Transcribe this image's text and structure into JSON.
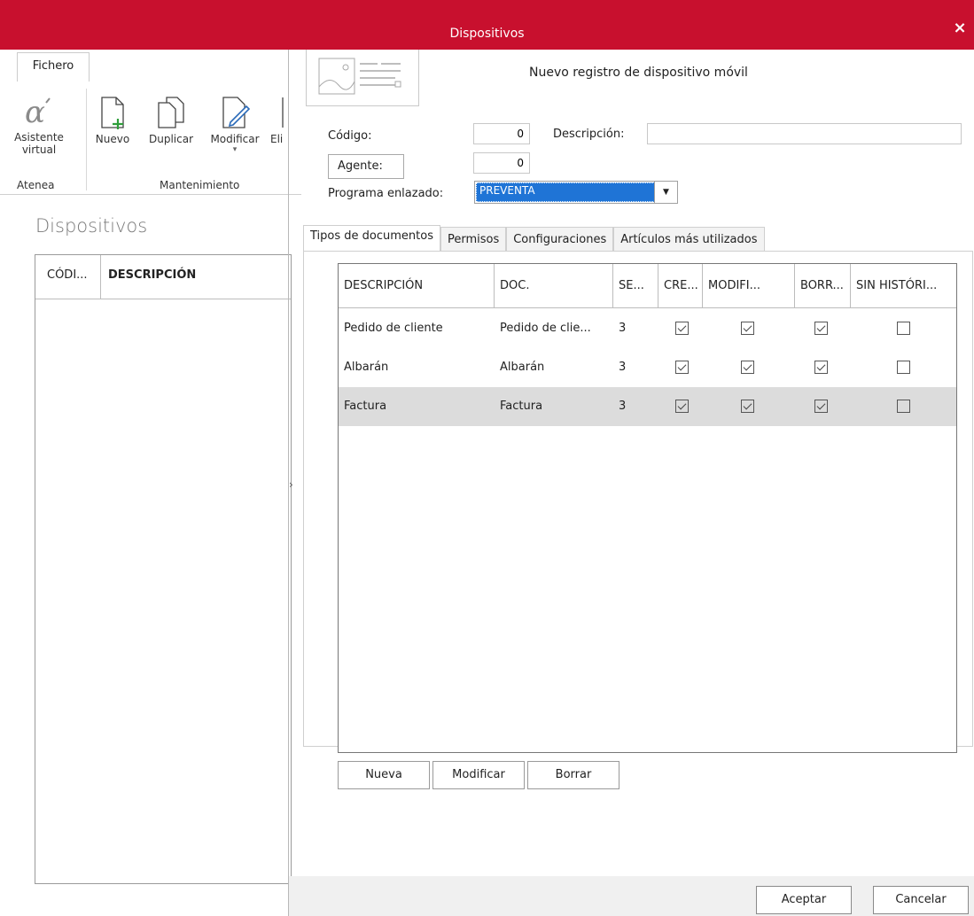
{
  "window": {
    "title": "Dispositivos",
    "close": "×"
  },
  "ribbon": {
    "tab": "Fichero",
    "buttons": {
      "asistente_line1": "Asistente",
      "asistente_line2": "virtual",
      "nuevo": "Nuevo",
      "duplicar": "Duplicar",
      "modificar": "Modificar",
      "eliminar_partial": "Eli"
    },
    "groups": {
      "atenea": "Atenea",
      "mantenimiento": "Mantenimiento"
    }
  },
  "left_panel": {
    "title": "Dispositivos",
    "columns": [
      "CÓDI...",
      "DESCRIPCIÓN"
    ],
    "expander": "›"
  },
  "dialog": {
    "header": "Nuevo registro de dispositivo móvil",
    "codigo_label": "Código:",
    "codigo_value": "0",
    "descripcion_label": "Descripción:",
    "descripcion_value": "",
    "agente_label": "Agente:",
    "agente_value": "0",
    "programa_label": "Programa enlazado:",
    "programa_value": "PREVENTA"
  },
  "tabs": [
    "Tipos de documentos",
    "Permisos",
    "Configuraciones",
    "Artículos más utilizados"
  ],
  "grid": {
    "columns": [
      "DESCRIPCIÓN",
      "DOC.",
      "SE...",
      "CRE...",
      "MODIFI...",
      "BORR...",
      "SIN HISTÓRI..."
    ],
    "rows": [
      {
        "descripcion": "Pedido de cliente",
        "doc": "Pedido de clie...",
        "serie": "3",
        "crear": true,
        "modificar": true,
        "borrar": true,
        "sin_historico": false
      },
      {
        "descripcion": "Albarán",
        "doc": "Albarán",
        "serie": "3",
        "crear": true,
        "modificar": true,
        "borrar": true,
        "sin_historico": false
      },
      {
        "descripcion": "Factura",
        "doc": "Factura",
        "serie": "3",
        "crear": true,
        "modificar": true,
        "borrar": true,
        "sin_historico": false
      }
    ],
    "selected_row": 2
  },
  "grid_buttons": {
    "nueva": "Nueva",
    "modificar": "Modificar",
    "borrar": "Borrar"
  },
  "footer": {
    "aceptar": "Aceptar",
    "cancelar": "Cancelar"
  },
  "colors": {
    "titlebar": "#c8102e",
    "selection": "#1f74d6",
    "selected_row": "#dcdcdc"
  }
}
